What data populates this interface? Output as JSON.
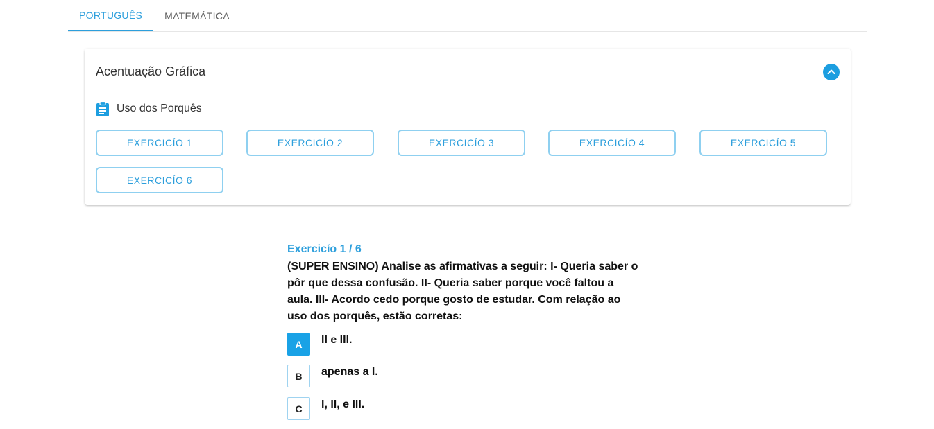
{
  "tabs": [
    {
      "label": "PORTUGUÊS",
      "active": true
    },
    {
      "label": "MATEMÁTICA",
      "active": false
    }
  ],
  "card": {
    "title": "Acentuação Gráfica",
    "collapse_icon": "chevron-up-icon",
    "topic": {
      "icon": "clipboard-icon",
      "label": "Uso dos Porquês"
    },
    "exercises": [
      "EXERCICÍO 1",
      "EXERCICÍO 2",
      "EXERCICÍO 3",
      "EXERCICÍO 4",
      "EXERCICÍO 5",
      "EXERCICÍO 6"
    ]
  },
  "exercise": {
    "heading": "Exercicío 1 / 6",
    "question": "(SUPER ENSINO) Analise as afirmativas a seguir: I- Queria saber o pôr que dessa confusão. II- Queria saber porque você faltou a aula. III- Acordo cedo porque gosto de estudar. Com relação ao uso dos porquês, estão corretas:",
    "options": [
      {
        "letter": "A",
        "text": "II e III.",
        "selected": true
      },
      {
        "letter": "B",
        "text": "apenas a I.",
        "selected": false
      },
      {
        "letter": "C",
        "text": "I, II, e III.",
        "selected": false
      }
    ]
  },
  "colors": {
    "accent": "#2d9fdc",
    "selected_option": "#19a2e6",
    "button_border": "#8fd0f0"
  }
}
